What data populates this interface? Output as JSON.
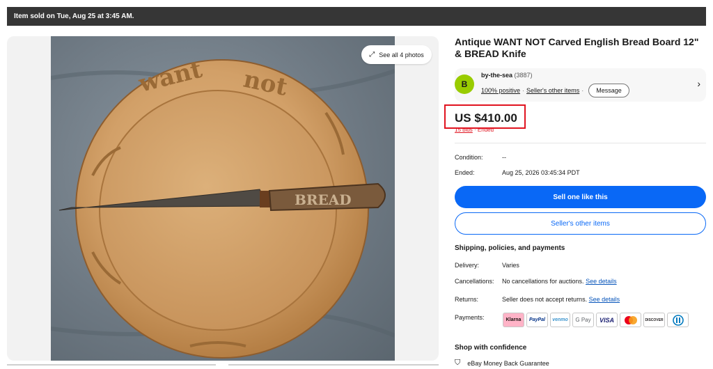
{
  "banner": {
    "text": "Item sold on Tue, Aug 25 at 3:45 AM."
  },
  "gallery": {
    "see_all_label": "See all 4 photos"
  },
  "listing": {
    "title": "Antique WANT NOT Carved English Bread Board 12\" & BREAD Knife"
  },
  "seller": {
    "avatar_letter": "B",
    "name": "by-the-sea",
    "feedback_count": "(3887)",
    "positive": "100% positive",
    "other_items_link": "Seller's other items",
    "message_label": "Message"
  },
  "price": {
    "amount": "US $410.00",
    "bids": "15 bids",
    "status": "Ended"
  },
  "details": {
    "condition_label": "Condition:",
    "condition_value": "--",
    "ended_label": "Ended:",
    "ended_value": "Aug 25, 2026 03:45:34 PDT"
  },
  "actions": {
    "sell_one_label": "Sell one like this",
    "seller_items_label": "Seller's other items"
  },
  "shipping": {
    "heading": "Shipping, policies, and payments",
    "delivery_label": "Delivery:",
    "delivery_value": "Varies",
    "cancellations_label": "Cancellations:",
    "cancellations_value": "No cancellations for auctions.",
    "returns_label": "Returns:",
    "returns_value": "Seller does not accept returns.",
    "see_details": "See details",
    "payments_label": "Payments:"
  },
  "payment_methods": [
    "Klarna",
    "PayPal",
    "venmo",
    "G Pay",
    "VISA",
    "mastercard",
    "DISCOVER",
    "Diners"
  ],
  "confidence": {
    "heading": "Shop with confidence",
    "guarantee": "eBay Money Back Guarantee"
  },
  "colors": {
    "accent": "#0968f6",
    "highlight": "#e0131f",
    "banner": "#363636"
  }
}
